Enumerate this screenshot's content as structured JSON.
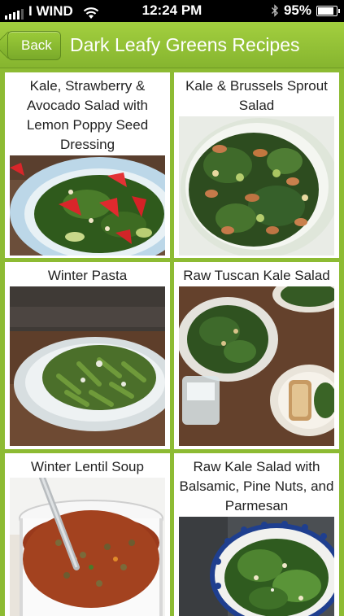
{
  "status_bar": {
    "carrier": "I WIND",
    "time": "12:24 PM",
    "battery": "95%",
    "battery_level": 0.95
  },
  "nav": {
    "back_label": "Back",
    "title": "Dark Leafy Greens Recipes"
  },
  "recipes": [
    {
      "title": "Kale, Strawberry & Avocado Salad with Lemon Poppy Seed Dressing"
    },
    {
      "title": "Kale & Brussels Sprout Salad"
    },
    {
      "title": "Winter Pasta"
    },
    {
      "title": "Raw Tuscan Kale Salad"
    },
    {
      "title": "Winter Lentil Soup"
    },
    {
      "title": "Raw Kale Salad with Balsamic, Pine Nuts, and Parmesan"
    }
  ],
  "colors": {
    "accent_green": "#8dbb33",
    "nav_green": "#95c43a"
  }
}
